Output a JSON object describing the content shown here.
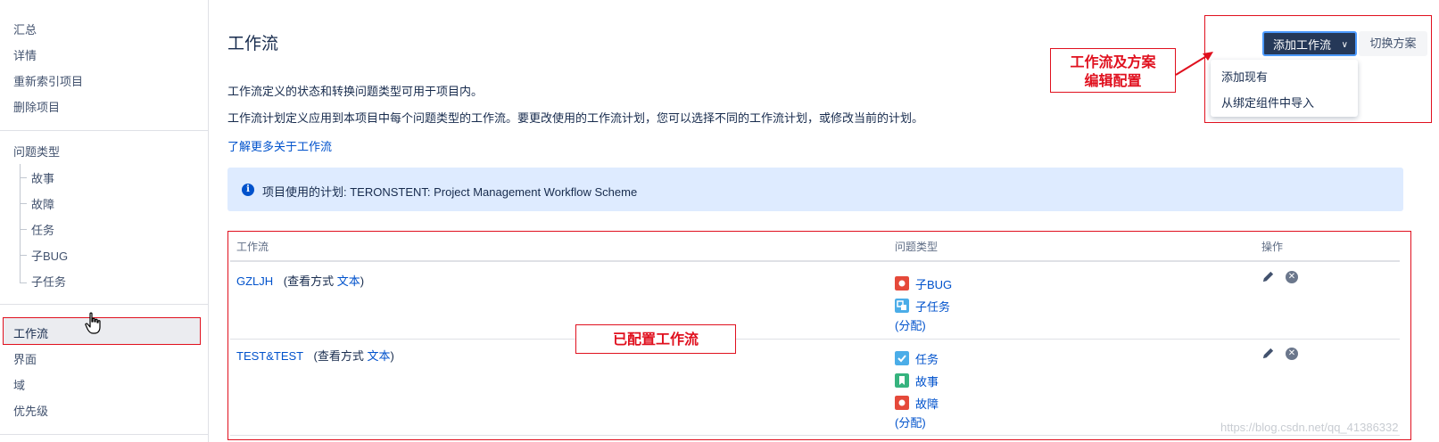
{
  "sidebar": {
    "top_items": [
      "汇总",
      "详情",
      "重新索引项目",
      "删除项目"
    ],
    "issue_types_heading": "问题类型",
    "issue_types": [
      "故事",
      "故障",
      "任务",
      "子BUG",
      "子任务"
    ],
    "bottom_items": [
      "工作流",
      "界面",
      "域",
      "优先级"
    ],
    "active_item": "工作流"
  },
  "main": {
    "title": "工作流",
    "desc1": "工作流定义的状态和转换问题类型可用于项目内。",
    "desc2": "工作流计划定义应用到本项目中每个问题类型的工作流。要更改使用的工作流计划，您可以选择不同的工作流计划，或修改当前的计划。",
    "learn_more": "了解更多关于工作流",
    "info": "项目使用的计划: TERONSTENT: Project Management Workflow Scheme"
  },
  "toolbar": {
    "add_workflow": "添加工作流",
    "switch_scheme": "切换方案",
    "dropdown": [
      "添加现有",
      "从绑定组件中导入"
    ]
  },
  "table": {
    "headers": {
      "workflow": "工作流",
      "issue_types": "问题类型",
      "actions": "操作"
    },
    "rows": [
      {
        "name": "GZLJH",
        "view_prefix": "(查看方式",
        "view_link": "文本",
        "view_suffix": ")",
        "issue_types": [
          "子BUG",
          "子任务"
        ],
        "assign": "(分配)"
      },
      {
        "name": "TEST&TEST",
        "view_prefix": "(查看方式",
        "view_link": "文本",
        "view_suffix": ")",
        "issue_types": [
          "任务",
          "故事",
          "故障"
        ],
        "assign": "(分配)"
      }
    ]
  },
  "annotations": {
    "scheme_note_line1": "工作流及方案",
    "scheme_note_line2": "编辑配置",
    "configured_note": "已配置工作流"
  },
  "watermark": "https://blog.csdn.net/qq_41386332",
  "colors": {
    "bug": "#e5493a",
    "subtask": "#4bade8",
    "task": "#4bade8",
    "story": "#36b37e",
    "annotation": "#e0101e",
    "link": "#0052cc"
  }
}
